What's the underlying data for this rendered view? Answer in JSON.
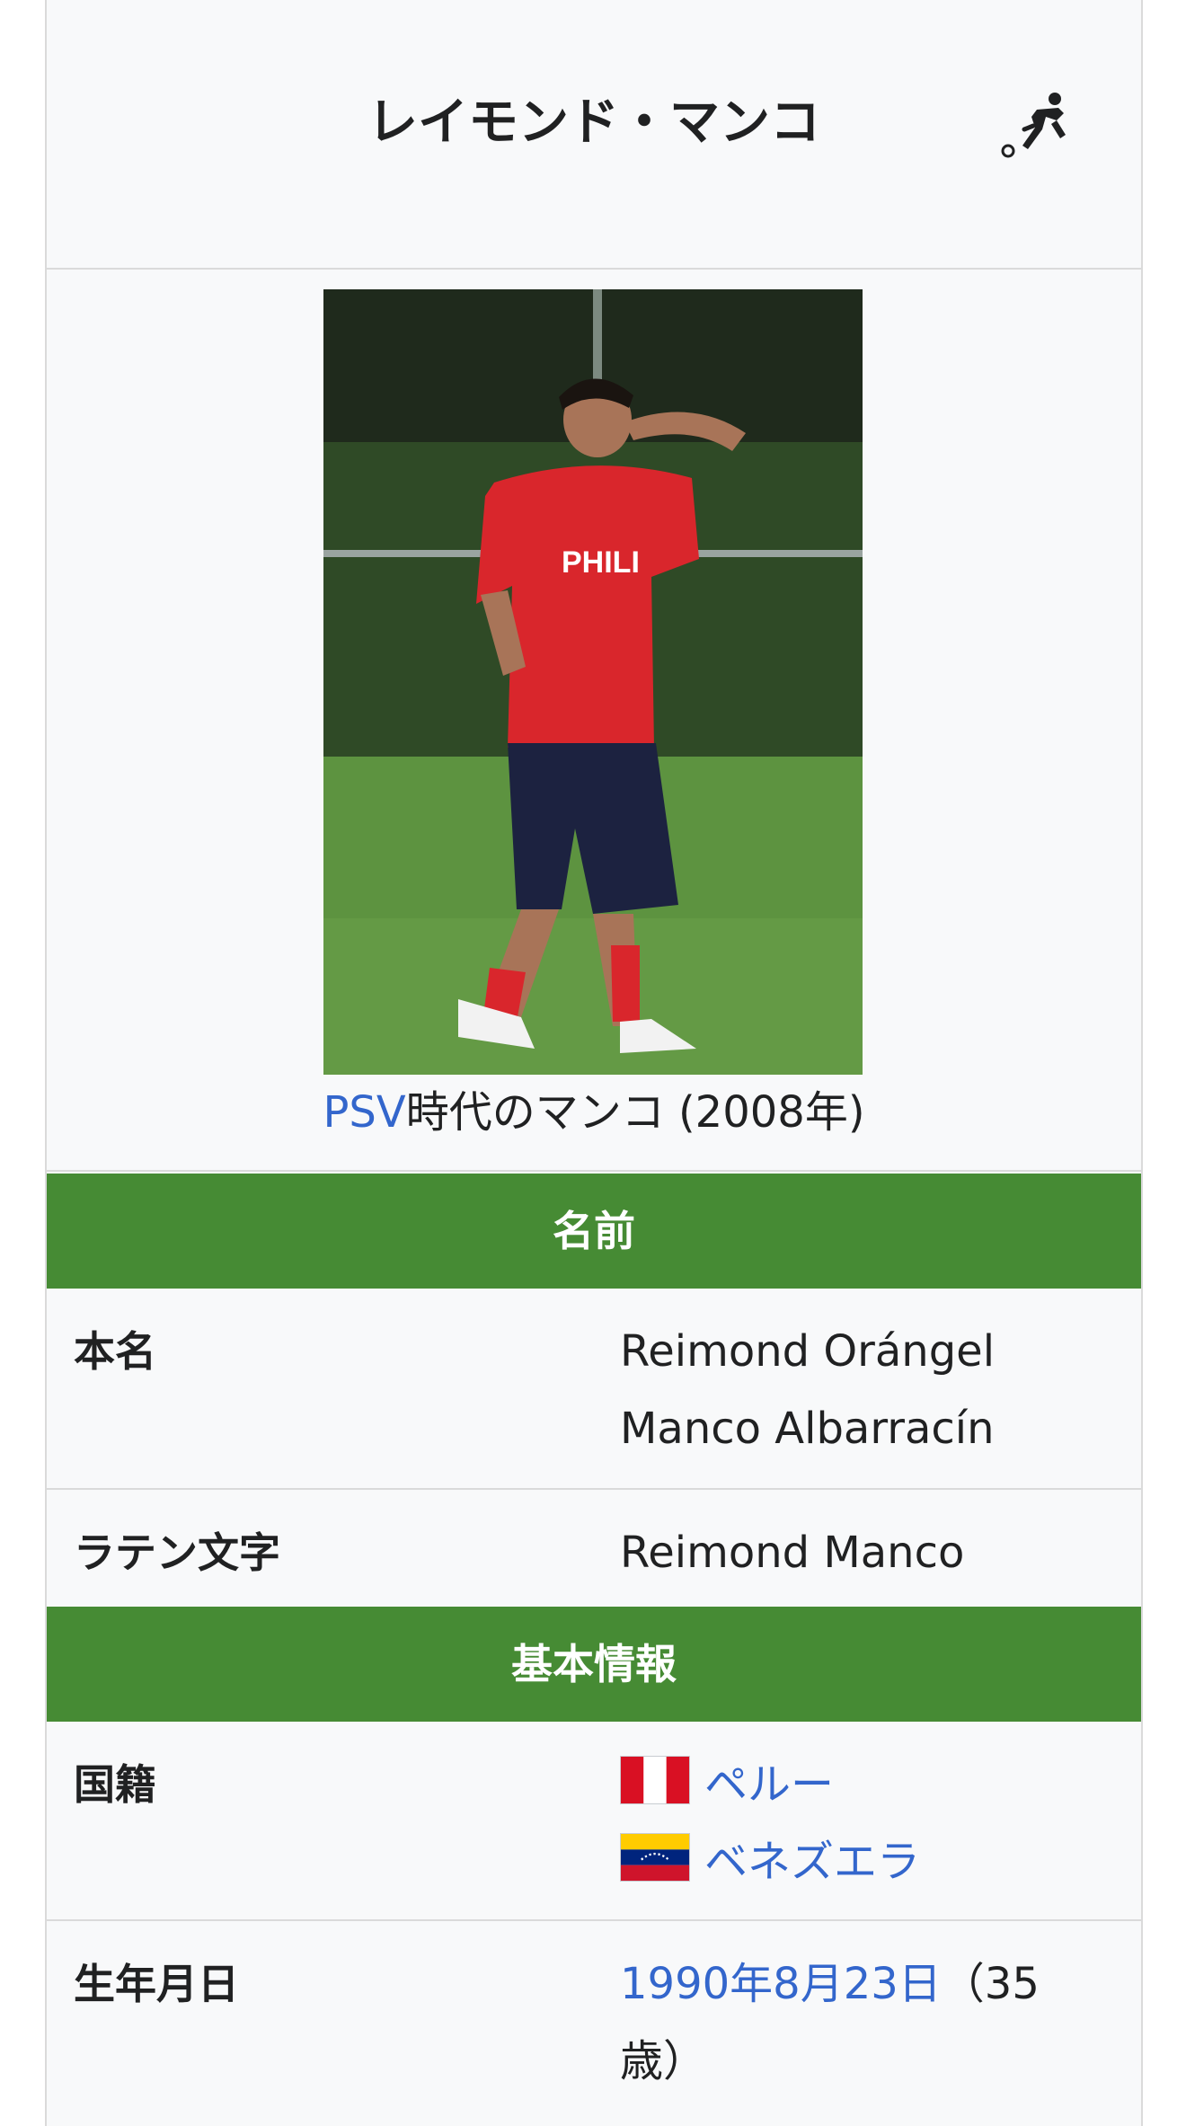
{
  "infobox": {
    "title": "レイモンド・マンコ",
    "title_icon": "soccer-player-kicking-icon",
    "image": {
      "caption_link": "PSV",
      "caption_text": "時代のマンコ (2008年)",
      "shirt_text": "PHILI"
    },
    "sections": [
      {
        "header": "名前",
        "rows": [
          {
            "label": "本名",
            "value_lines": [
              "Reimond Orángel",
              "Manco Albarracín"
            ]
          },
          {
            "label": "ラテン文字",
            "value_lines": [
              "Reimond Manco"
            ]
          }
        ]
      },
      {
        "header": "基本情報",
        "rows": [
          {
            "label": "国籍",
            "nationalities": [
              {
                "flag": "peru-flag-icon",
                "name": "ペルー"
              },
              {
                "flag": "venezuela-flag-icon",
                "name": "ベネズエラ"
              }
            ]
          },
          {
            "label": "生年月日",
            "birth_date_link": "1990年8月23日",
            "age_text": "（35",
            "age_text_2": "歳）"
          }
        ]
      }
    ]
  },
  "colors": {
    "section_header_bg": "#468b34",
    "link": "#3366cc",
    "infobox_bg": "#f8f9fa",
    "border": "#dadada"
  }
}
